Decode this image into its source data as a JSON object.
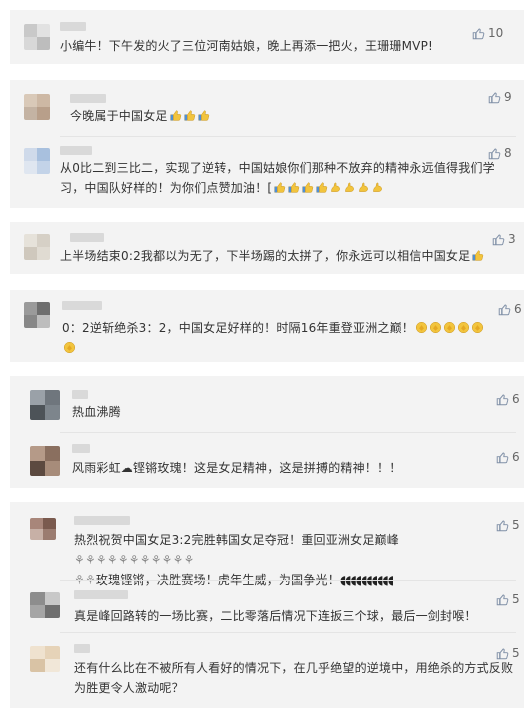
{
  "colors": {
    "card_bg": "#f3f3f3",
    "like_icon": "#7f8fa6",
    "emoji_yellow": "#f2c43d"
  },
  "comments": [
    {
      "text": "小编牛！下午发的火了三位河南姑娘，晚上再添一把火，王珊珊MVP!",
      "likes": "10"
    },
    {
      "text": "今晚属于中国女足",
      "likes": "9"
    },
    {
      "text_line1": "从0比二到三比二，实现了逆转，中国姑娘你们那种不放弃的精神永远值得我们学",
      "text_line2": "习，中国队好样的！为你们点赞加油！[",
      "likes": "8"
    },
    {
      "text": "上半场结束0:2我都以为无了，下半场踢的太拼了，你永远可以相信中国女足",
      "likes": "3"
    },
    {
      "text": "0：2逆斩绝杀3：2，中国女足好样的！时隔16年重登亚洲之巅！",
      "likes": "6"
    },
    {
      "text": "热血沸腾",
      "likes": "6"
    },
    {
      "text": "风雨彩虹☁铿锵玫瑰！这是女足精神，这是拼搏的精神！！！",
      "likes": "6"
    },
    {
      "text_line1": "热烈祝贺中国女足3:2完胜韩国女足夺冠！重回亚洲女足巅峰",
      "text_line2": "玫瑰铿锵，决胜赛场！虎年生威，为国争光！",
      "likes": "5"
    },
    {
      "text": "真是峰回路转的一场比赛，二比零落后情况下连扳三个球，最后一剑封喉！",
      "likes": "5"
    },
    {
      "text_line1": "还有什么比在不被所有人看好的情况下，在几乎绝望的逆境中，用绝杀的方式反败",
      "text_line2": "为胜更令人激动呢？",
      "likes": "5"
    }
  ],
  "icons": {
    "like": "thumbs-up-outline-icon",
    "emoji": "thumbs-up-emoji-icon",
    "rose": "rose-emoji-icon",
    "flex": "flexed-arm-emoji-icon",
    "clap": "clapping-emoji-icon"
  }
}
